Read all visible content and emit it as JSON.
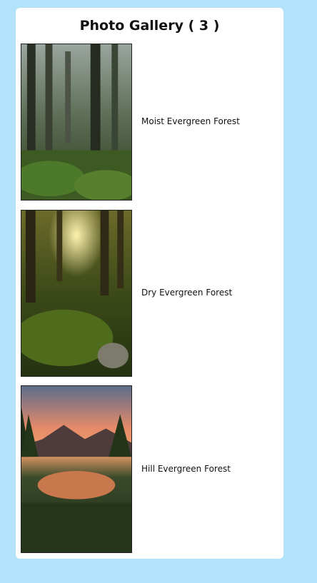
{
  "gallery": {
    "title": "Photo Gallery ( 3 )",
    "items": [
      {
        "caption": "Moist Evergreen Forest",
        "image_desc": "misty-forest-photo"
      },
      {
        "caption": "Dry Evergreen Forest",
        "image_desc": "sunlit-mossy-forest-photo"
      },
      {
        "caption": "Hill Evergreen Forest",
        "image_desc": "mountain-lake-sunset-photo"
      }
    ]
  },
  "colors": {
    "page_bg": "#b3e3fa",
    "card_bg": "#ffffff"
  }
}
